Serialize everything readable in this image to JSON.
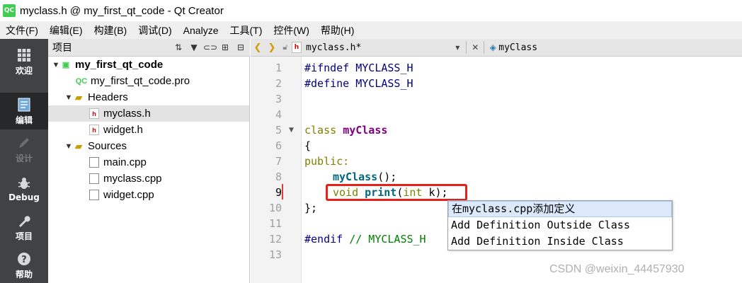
{
  "window": {
    "title": "myclass.h @ my_first_qt_code - Qt Creator",
    "app_icon": "QC"
  },
  "menu": [
    "文件(F)",
    "编辑(E)",
    "构建(B)",
    "调试(D)",
    "Analyze",
    "工具(T)",
    "控件(W)",
    "帮助(H)"
  ],
  "modes": [
    {
      "label": "欢迎",
      "icon": "grid-icon"
    },
    {
      "label": "编辑",
      "icon": "edit-doc-icon"
    },
    {
      "label": "设计",
      "icon": "pencil-icon"
    },
    {
      "label": "Debug",
      "icon": "bug-icon"
    },
    {
      "label": "项目",
      "icon": "wrench-icon"
    },
    {
      "label": "帮助",
      "icon": "help-icon"
    }
  ],
  "project_pane": {
    "title": "项目",
    "tree": [
      {
        "text": "my_first_qt_code",
        "kind": "project"
      },
      {
        "text": "my_first_qt_code.pro",
        "kind": "pro"
      },
      {
        "text": "Headers",
        "kind": "folder"
      },
      {
        "text": "myclass.h",
        "kind": "h"
      },
      {
        "text": "widget.h",
        "kind": "h"
      },
      {
        "text": "Sources",
        "kind": "folder"
      },
      {
        "text": "main.cpp",
        "kind": "cpp"
      },
      {
        "text": "myclass.cpp",
        "kind": "cpp"
      },
      {
        "text": "widget.cpp",
        "kind": "cpp"
      }
    ]
  },
  "editor_toolbar": {
    "file": "myclass.h*",
    "symbol": "myClass"
  },
  "editor": {
    "line_numbers": [
      "1",
      "2",
      "3",
      "4",
      "5",
      "6",
      "7",
      "8",
      "9",
      "10",
      "11",
      "12",
      "13"
    ],
    "current_line": "9",
    "code": {
      "l1_a": "#ifndef",
      "l1_b": " MYCLASS_H",
      "l2_a": "#define",
      "l2_b": " MYCLASS_H",
      "l5_a": "class",
      "l5_b": "myClass",
      "l6": "{",
      "l7": "public:",
      "l8_a": "myClass",
      "l8_b": "();",
      "l9_a": "void",
      "l9_b": "print",
      "l9_c": "(",
      "l9_d": "int",
      "l9_e": " k);",
      "l10": "};",
      "l12_a": "#endif",
      "l12_b": " // MYCLASS_H"
    }
  },
  "popup": {
    "items": [
      "在myclass.cpp添加定义",
      "Add Definition Outside Class",
      "Add Definition Inside Class"
    ]
  },
  "watermark": "CSDN @weixin_44457930"
}
